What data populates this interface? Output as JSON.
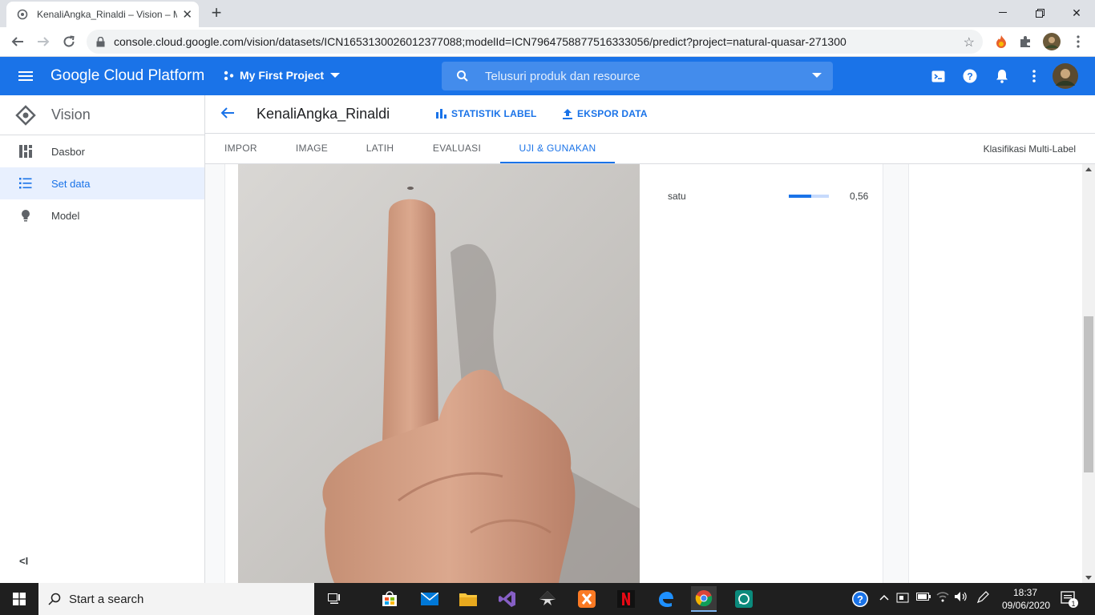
{
  "browser": {
    "tab_title": "KenaliAngka_Rinaldi – Vision – M",
    "url": "console.cloud.google.com/vision/datasets/ICN1653130026012377088;modelId=ICN7964758877516333056/predict?project=natural-quasar-271300"
  },
  "header": {
    "brand": "Google Cloud Platform",
    "project": "My First Project",
    "search_placeholder": "Telusuri produk dan resource"
  },
  "sidebar": {
    "product": "Vision",
    "items": [
      {
        "label": "Dasbor",
        "icon": "dashboard-icon"
      },
      {
        "label": "Set data",
        "icon": "list-icon"
      },
      {
        "label": "Model",
        "icon": "lightbulb-icon"
      }
    ],
    "collapse_label": "<I"
  },
  "toolbar": {
    "dataset_title": "KenaliAngka_Rinaldi",
    "stats_label": "STATISTIK LABEL",
    "export_label": "EKSPOR DATA"
  },
  "tabs": [
    {
      "label": "IMPOR"
    },
    {
      "label": "IMAGE"
    },
    {
      "label": "LATIH"
    },
    {
      "label": "EVALUASI"
    },
    {
      "label": "UJI & GUNAKAN"
    }
  ],
  "model_type": "Klasifikasi Multi-Label",
  "prediction": {
    "label": "satu",
    "score_text": "0,56",
    "score": 0.56
  },
  "taskbar": {
    "search_text": "Start a search",
    "time": "18:37",
    "date": "09/06/2020",
    "notif_count": "1"
  },
  "colors": {
    "gcp_blue": "#1a73e8",
    "active_bg": "#e8f0fe"
  }
}
